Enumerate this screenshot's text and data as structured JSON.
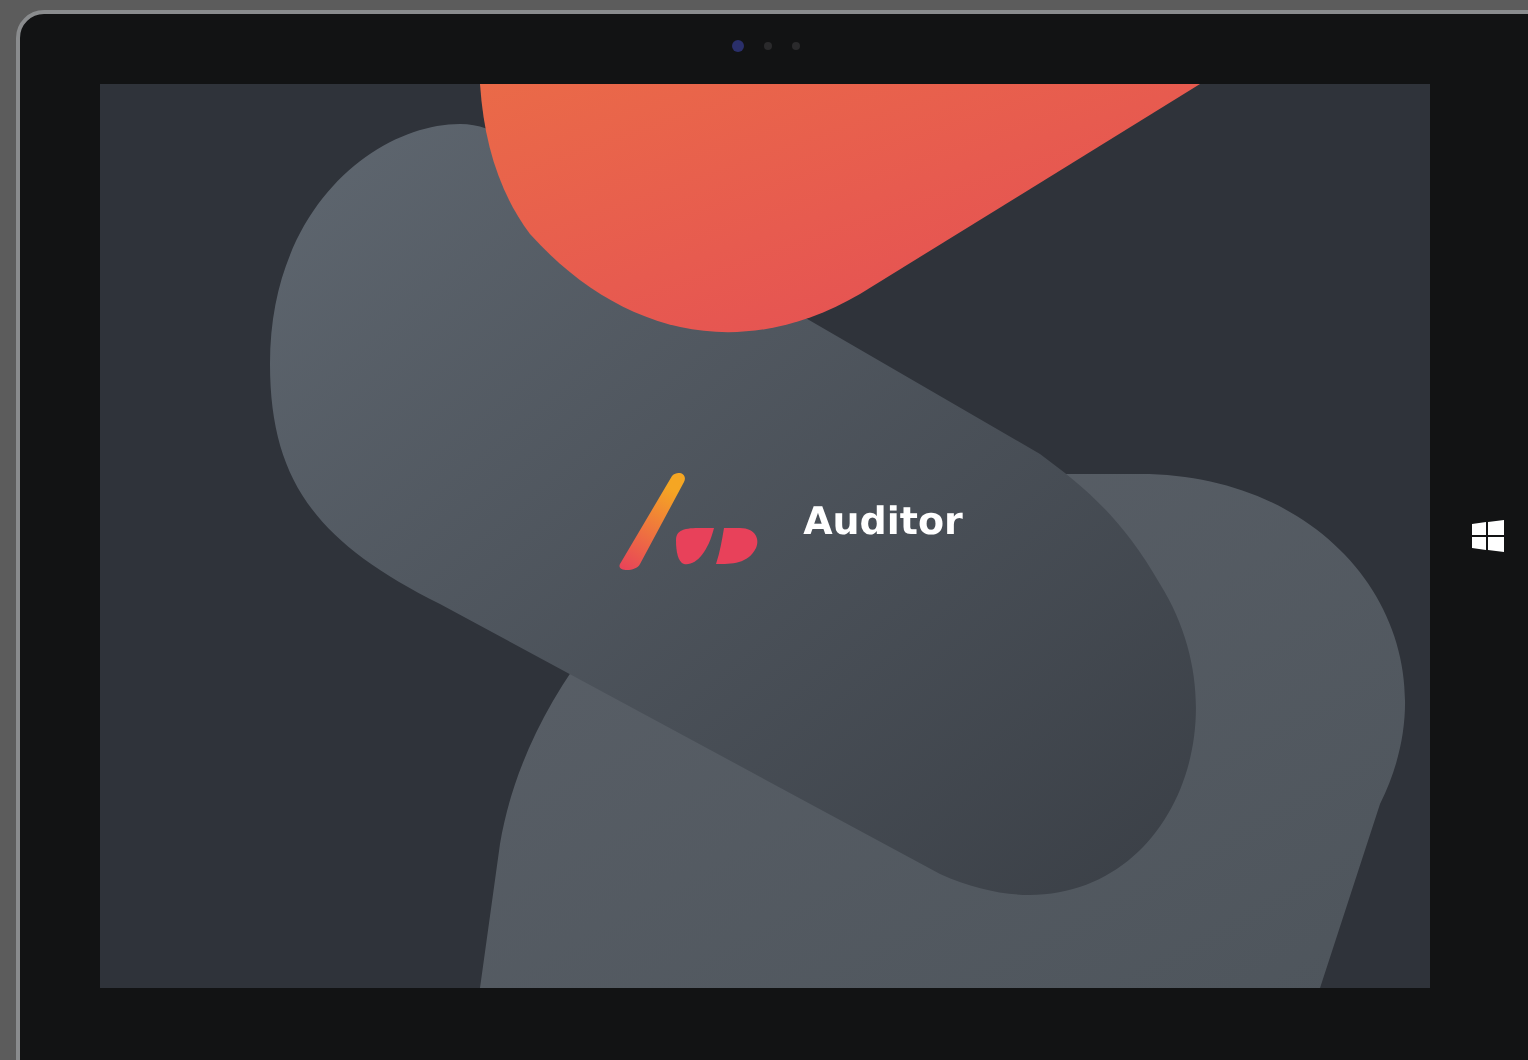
{
  "splash_screen": {
    "app_name": "Auditor"
  }
}
